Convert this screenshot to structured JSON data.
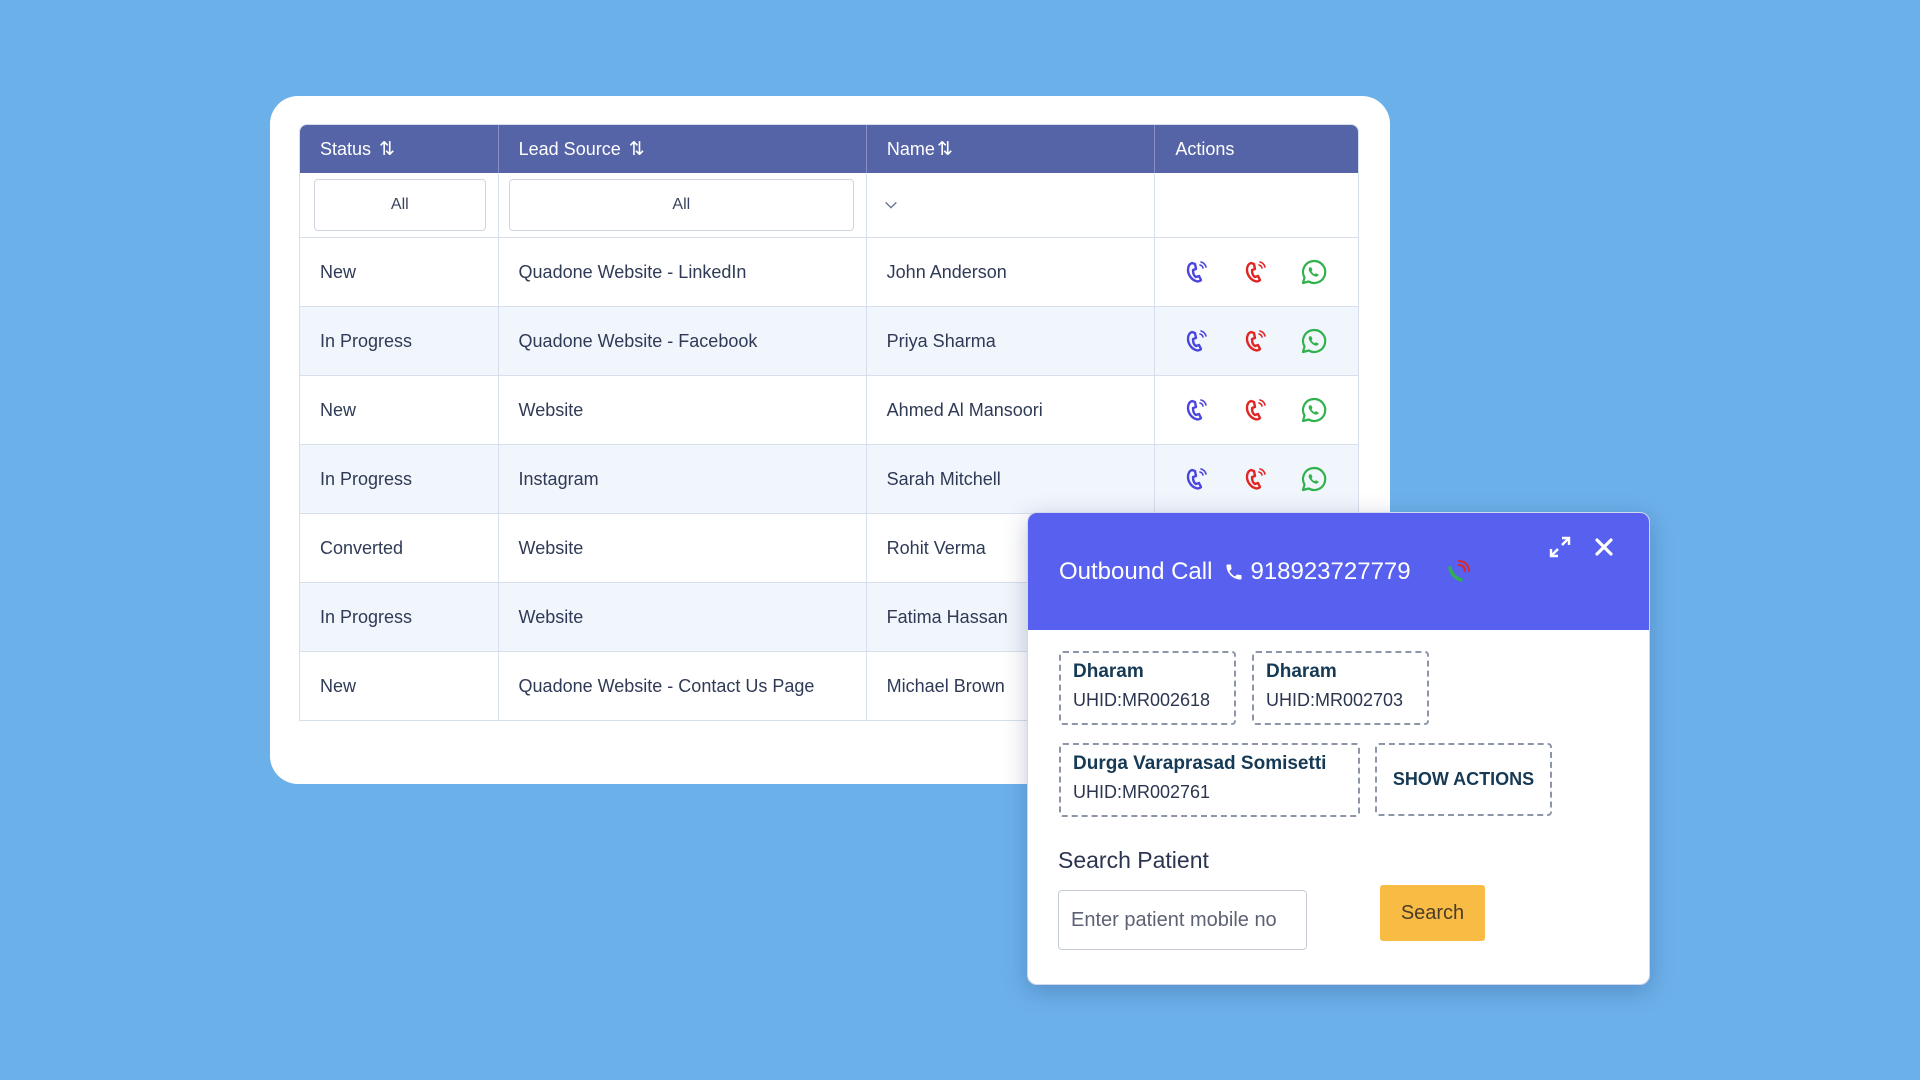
{
  "table": {
    "headers": {
      "status": "Status",
      "lead_source": "Lead Source",
      "name": "Name",
      "actions": "Actions"
    },
    "sort_glyph": "⇅",
    "filters": {
      "status": "All",
      "lead_source": "All",
      "name_dropdown_icon": "chevron-down-icon"
    },
    "rows": [
      {
        "status": "New",
        "lead_source": "Quadone Website - LinkedIn",
        "name": "John Anderson"
      },
      {
        "status": "In Progress",
        "lead_source": "Quadone Website - Facebook",
        "name": "Priya Sharma"
      },
      {
        "status": "New",
        "lead_source": "Website",
        "name": "Ahmed Al Mansoori"
      },
      {
        "status": "In Progress",
        "lead_source": "Instagram",
        "name": "Sarah Mitchell"
      },
      {
        "status": "Converted",
        "lead_source": "Website",
        "name": "Rohit Verma"
      },
      {
        "status": "In Progress",
        "lead_source": "Website",
        "name": "Fatima Hassan"
      },
      {
        "status": "New",
        "lead_source": "Quadone Website - Contact Us Page",
        "name": "Michael Brown"
      }
    ],
    "action_icons": [
      "call-icon",
      "phone-ring-icon",
      "whatsapp-icon"
    ],
    "colors": {
      "call": "#4b45e0",
      "ring": "#e02525",
      "whatsapp": "#2fb24c",
      "header": "#5563a7"
    }
  },
  "dialog": {
    "title": "Outbound Call",
    "number": "918923727779",
    "patients": [
      {
        "name": "Dharam",
        "uhid": "UHID:MR002618"
      },
      {
        "name": "Dharam",
        "uhid": "UHID:MR002703"
      },
      {
        "name": "Durga Varaprasad Somisetti",
        "uhid": "UHID:MR002761"
      }
    ],
    "show_actions": "SHOW ACTIONS",
    "search_label": "Search Patient",
    "search_placeholder": "Enter patient mobile no",
    "search_button": "Search",
    "colors": {
      "header": "#5760ef",
      "search_button": "#f8bc45"
    }
  }
}
